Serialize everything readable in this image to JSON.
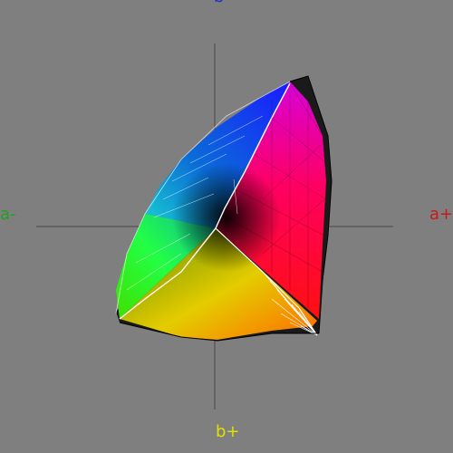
{
  "axes": {
    "a_plus": {
      "label": "a+",
      "color": "#c81a1a"
    },
    "a_minus": {
      "label": "a-",
      "color": "#1fa01f"
    },
    "b_plus": {
      "label": "b+",
      "color": "#e0e000"
    },
    "b_minus": {
      "label": "b-",
      "color": "#2030c0"
    }
  },
  "colors": {
    "background": "#7f7f7f",
    "axis_line": "#4a4a4a",
    "wire_front": "#ffffff",
    "wire_back": "#111111"
  }
}
